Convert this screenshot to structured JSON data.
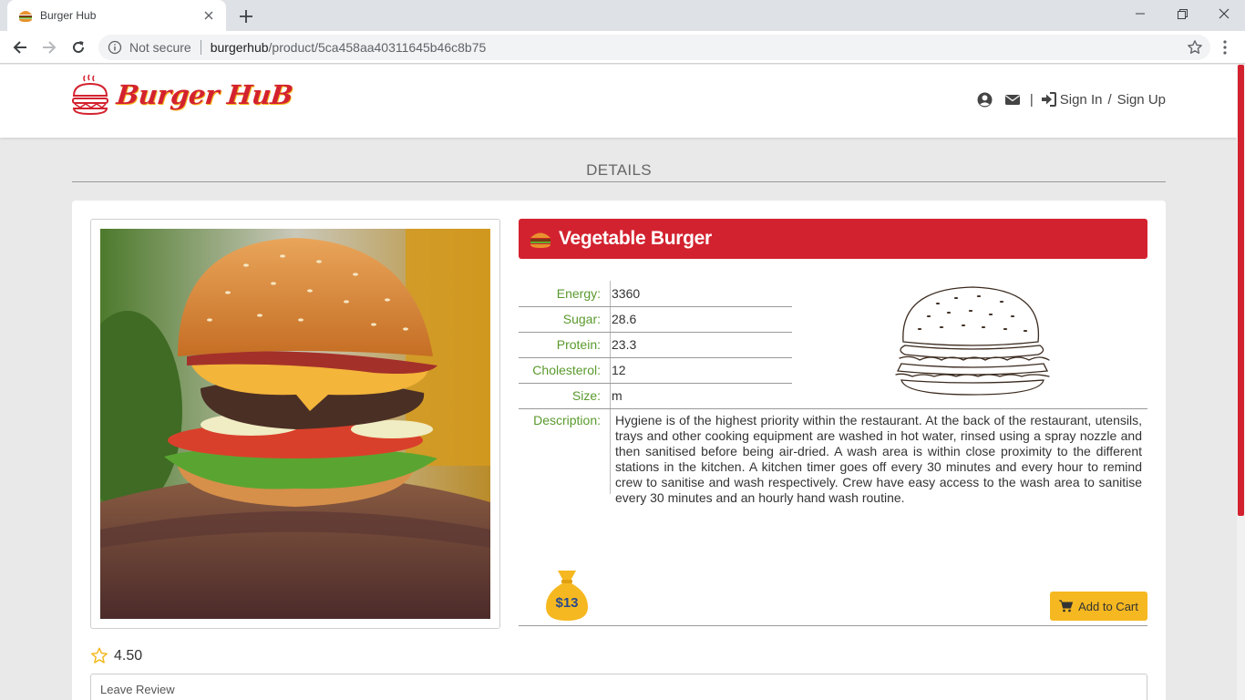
{
  "browser": {
    "tab_title": "Burger Hub",
    "omnibox_security": "Not secure",
    "url_host": "burgerhub",
    "url_path": "/product/5ca458aa40311645b46c8b75"
  },
  "header": {
    "logo_text": "Burger HuB",
    "signin_label": "Sign In",
    "separator": "/",
    "signup_label": "Sign Up",
    "divider": "|"
  },
  "page": {
    "section_title": "DETAILS"
  },
  "product": {
    "name": "Vegetable Burger",
    "specs": [
      {
        "label": "Energy:",
        "value": "3360"
      },
      {
        "label": "Sugar:",
        "value": "28.6"
      },
      {
        "label": "Protein:",
        "value": "23.3"
      },
      {
        "label": "Cholesterol:",
        "value": "12"
      },
      {
        "label": "Size:",
        "value": "m"
      }
    ],
    "description_label": "Description:",
    "description": "Hygiene is of the highest priority within the restaurant. At the back of the restaurant, utensils, trays and other cooking equipment are washed in hot water, rinsed using a spray nozzle and then sanitised before being air-dried. A wash area is within close proximity to the different stations in the kitchen. A kitchen timer goes off every 30 minutes and every hour to remind crew to sanitise and wash respectively. Crew have easy access to the wash area to sanitise every 30 minutes and an hourly hand wash routine.",
    "price": "$13",
    "add_to_cart_label": "Add to Cart",
    "rating": "4.50",
    "review_placeholder": "Leave Review"
  },
  "colors": {
    "brand_red": "#d3222f",
    "accent_yellow": "#f6b820",
    "label_green": "#5a9a2d"
  }
}
